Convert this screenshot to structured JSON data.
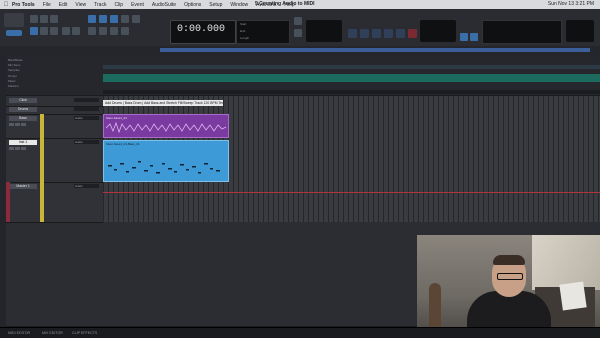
{
  "menubar": {
    "app": "Pro Tools",
    "items": [
      "File",
      "Edit",
      "View",
      "Track",
      "Clip",
      "Event",
      "AudioSuite",
      "Options",
      "Setup",
      "Window",
      "Avid Link",
      "Help"
    ],
    "window_title": "5.Counting Audio to MIDI",
    "clock": "Sun Nov 13  3:21 PM"
  },
  "toolbar": {
    "counter": "0:00.000",
    "counter_sublabels": [
      "Start",
      "End",
      "Length"
    ]
  },
  "tracks": [
    {
      "name": "Click",
      "io": ""
    },
    {
      "name": "Drums",
      "io": ""
    },
    {
      "name": "Bass",
      "io": "Audio"
    },
    {
      "name": "Inst 1",
      "io": "Audio"
    },
    {
      "name": "Master 1",
      "io": "Audio"
    }
  ],
  "clips": {
    "title_clip": "Add Drums | Bass Drum | Add Bass and Stretch Fill/Sweep Track 120 BPM Tempo",
    "audio_clip": "Stem-bass1_01",
    "midi_clip": "Stem-bass1_01-Bass_01"
  },
  "ruler_labels": [
    "Bars/Beats",
    "Min:Secs",
    "Samples",
    "Tempo",
    "Meter",
    "Markers"
  ],
  "bottombar": {
    "left": "MIDI EDITOR",
    "middle": "MIX EDITOR",
    "right": "CLIP EFFECTS"
  },
  "colors": {
    "accent": "#3a6ea8",
    "audio_clip": "#7a3aa0",
    "midi_clip": "#3d9ad6",
    "tempo_band": "#1d6b5e",
    "playhead": "#b0323a"
  }
}
